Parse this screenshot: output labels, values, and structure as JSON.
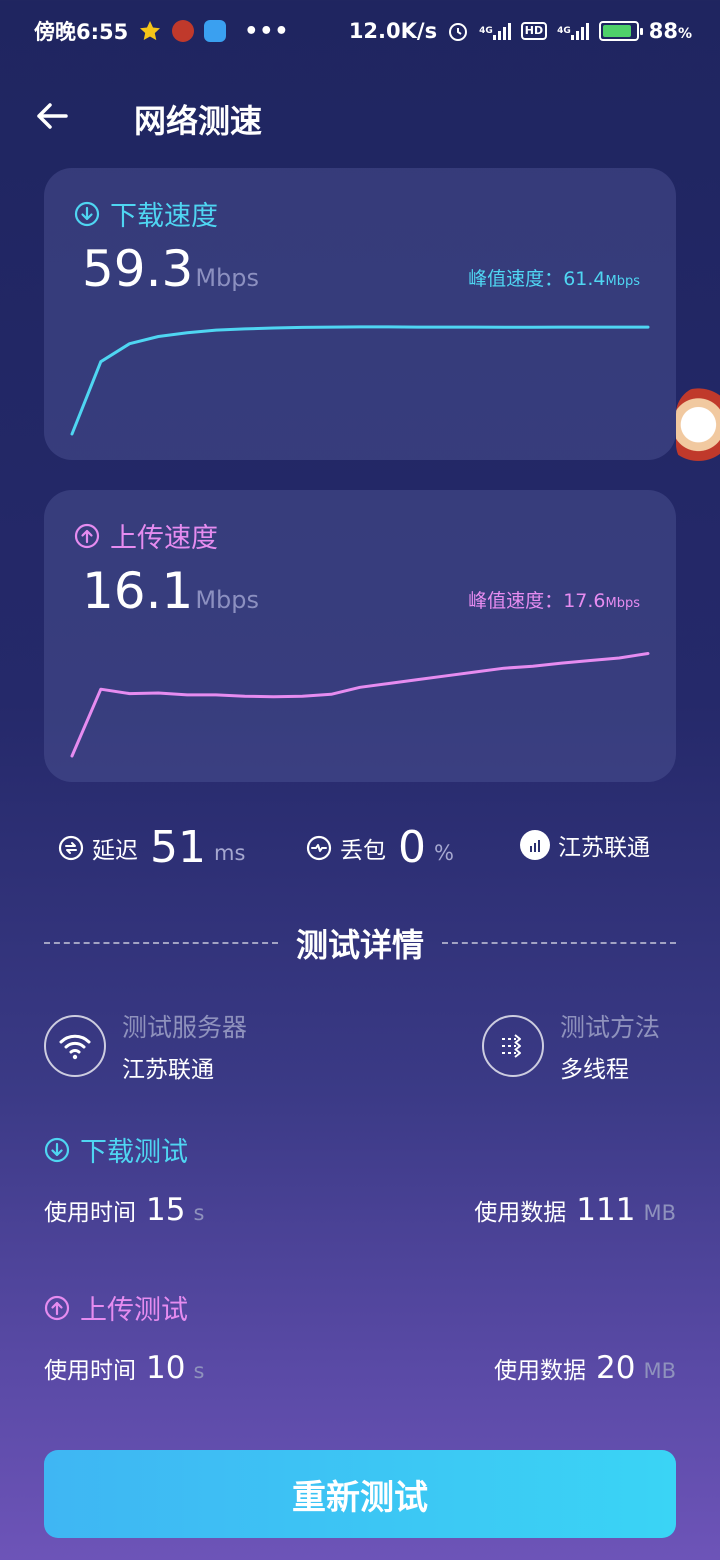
{
  "status_bar": {
    "time": "傍晚6:55",
    "net_speed": "12.0K/s",
    "net_type_1": "4G",
    "hd_label": "HD",
    "net_type_2": "4G",
    "battery": "88"
  },
  "header": {
    "title": "网络测速"
  },
  "download_card": {
    "title": "下载速度",
    "speed": "59.3",
    "unit": "Mbps",
    "peak_label": "峰值速度：",
    "peak_value": "61.4",
    "peak_unit": "Mbps",
    "color": "#4fd6f2"
  },
  "upload_card": {
    "title": "上传速度",
    "speed": "16.1",
    "unit": "Mbps",
    "peak_label": "峰值速度：",
    "peak_value": "17.6",
    "peak_unit": "Mbps",
    "color": "#e68cf0"
  },
  "metrics": {
    "latency_label": "延迟",
    "latency_value": "51",
    "latency_unit": "ms",
    "loss_label": "丢包",
    "loss_value": "0",
    "loss_unit": "%",
    "isp": "江苏联通"
  },
  "details": {
    "section_title": "测试详情",
    "server_label": "测试服务器",
    "server_value": "江苏联通",
    "method_label": "测试方法",
    "method_value": "多线程"
  },
  "download_test": {
    "title": "下载测试",
    "time_label": "使用时间",
    "time_value": "15",
    "time_unit": "s",
    "data_label": "使用数据",
    "data_value": "111",
    "data_unit": "MB"
  },
  "upload_test": {
    "title": "上传测试",
    "time_label": "使用时间",
    "time_value": "10",
    "time_unit": "s",
    "data_label": "使用数据",
    "data_value": "20",
    "data_unit": "MB"
  },
  "retest_button": {
    "label": "重新测试"
  },
  "chart_data": [
    {
      "type": "line",
      "title": "下载速度",
      "x": [
        0,
        1,
        2,
        3,
        4,
        5,
        6,
        7,
        8,
        9,
        10,
        11,
        12,
        13,
        14,
        15,
        16,
        17,
        18,
        19,
        20
      ],
      "series": [
        {
          "values": [
            0,
            40,
            50,
            54,
            56,
            57.5,
            58.2,
            58.7,
            59,
            59.2,
            59.3,
            59.3,
            59.2,
            59.2,
            59.2,
            59.1,
            59.1,
            59.2,
            59.2,
            59.2,
            59.2
          ]
        }
      ],
      "ylim": [
        0,
        62
      ]
    },
    {
      "type": "line",
      "title": "上传速度",
      "x": [
        0,
        1,
        2,
        3,
        4,
        5,
        6,
        7,
        8,
        9,
        10,
        11,
        12,
        13,
        14,
        15,
        16,
        17,
        18,
        19,
        20
      ],
      "series": [
        {
          "values": [
            0,
            10.5,
            9.8,
            9.9,
            9.6,
            9.6,
            9.4,
            9.3,
            9.4,
            9.7,
            10.8,
            11.4,
            12,
            12.6,
            13.2,
            13.8,
            14.1,
            14.6,
            15,
            15.4,
            16.1
          ]
        }
      ],
      "ylim": [
        0,
        17.6
      ]
    }
  ]
}
